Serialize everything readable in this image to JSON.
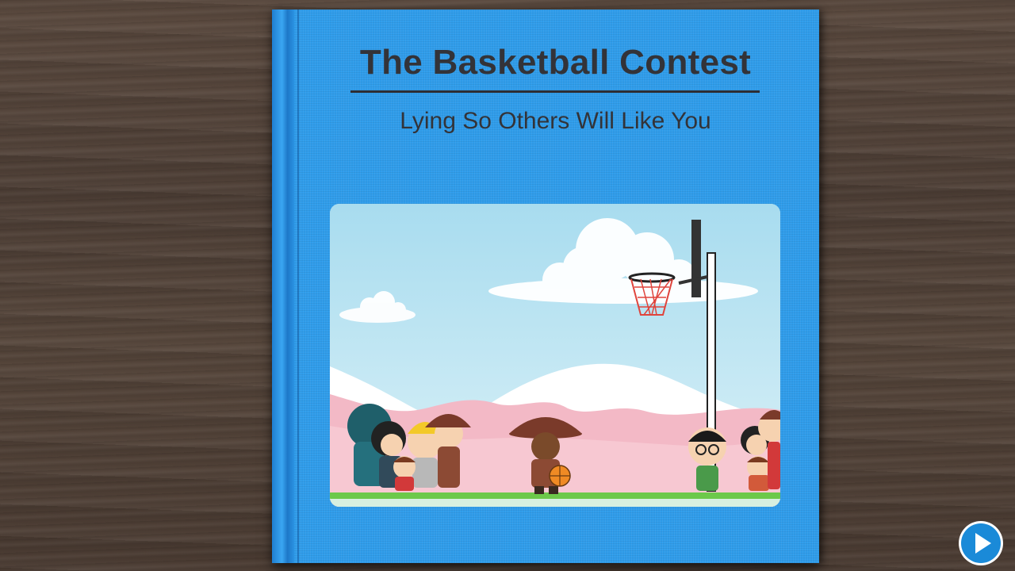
{
  "book": {
    "title": "The Basketball Contest",
    "subtitle": "Lying So Others Will Like You",
    "cover_color": "#2f9cea"
  },
  "illustration": {
    "description_icon": "basketball-court-scene-icon"
  },
  "controls": {
    "play_icon": "play-icon",
    "accent": "#1a8ad8"
  }
}
